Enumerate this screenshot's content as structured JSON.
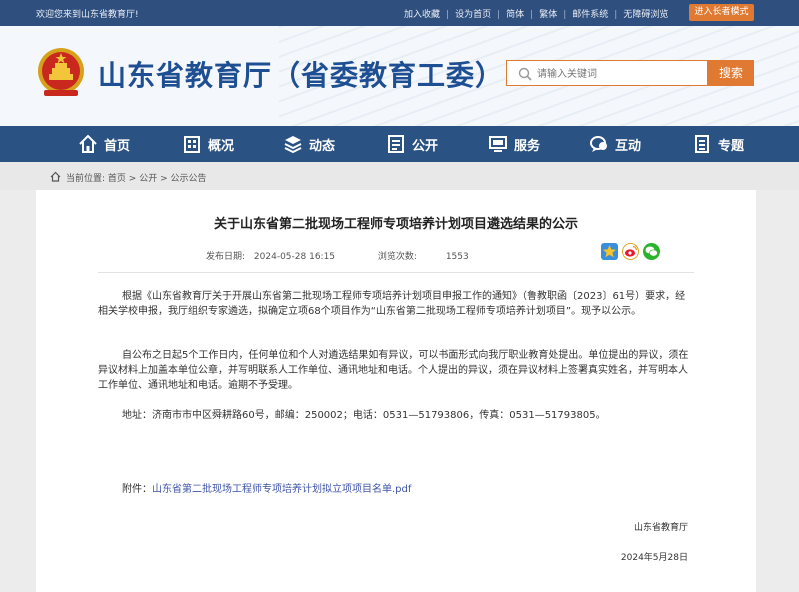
{
  "topbar": {
    "welcome": "欢迎您来到山东省教育厅!",
    "links": [
      "加入收藏",
      "设为首页",
      "简体",
      "繁体",
      "邮件系统",
      "无障碍浏览"
    ],
    "elder_mode": "进入长者模式"
  },
  "header": {
    "site_title": "山东省教育厅（省委教育工委）",
    "search_placeholder": "请输入关键词",
    "search_button": "搜索"
  },
  "nav": {
    "items": [
      {
        "label": "首页",
        "icon": "home-icon"
      },
      {
        "label": "概况",
        "icon": "building-icon"
      },
      {
        "label": "动态",
        "icon": "layers-icon"
      },
      {
        "label": "公开",
        "icon": "document-icon"
      },
      {
        "label": "服务",
        "icon": "monitor-icon"
      },
      {
        "label": "互动",
        "icon": "chat-icon"
      },
      {
        "label": "专题",
        "icon": "list-icon"
      }
    ]
  },
  "breadcrumb": {
    "prefix": "当前位置:",
    "items": [
      "首页",
      "公开",
      "公示公告"
    ]
  },
  "article": {
    "title": "关于山东省第二批现场工程师专项培养计划项目遴选结果的公示",
    "publish_label": "发布日期:",
    "publish_date": "2024-05-28 16:15",
    "views_label": "浏览次数:",
    "views": "1553",
    "paragraphs": [
      "根据《山东省教育厅关于开展山东省第二批现场工程师专项培养计划项目申报工作的通知》（鲁教职函〔2023〕61号）要求，经相关学校申报，我厅组织专家遴选，拟确定立项68个项目作为“山东省第二批现场工程师专项培养计划项目”。现予以公示。",
      "自公布之日起5个工作日内，任何单位和个人对遴选结果如有异议，可以书面形式向我厅职业教育处提出。单位提出的异议，须在异议材料上加盖本单位公章，并写明联系人工作单位、通讯地址和电话。个人提出的异议，须在异议材料上签署真实姓名，并写明本人工作单位、通讯地址和电话。逾期不予受理。",
      "地址：济南市市中区舜耕路60号，邮编：250002；电话：0531—51793806，传真：0531—51793805。"
    ],
    "attachment_label": "附件：",
    "attachment_file": "山东省第二批现场工程师专项培养计划拟立项项目名单.pdf",
    "signature": "山东省教育厅",
    "sign_date": "2024年5月28日"
  },
  "colors": {
    "topbar": "#2f4f7e",
    "nav": "#2a5283",
    "accent": "#e07a32",
    "title": "#1f4f93",
    "link": "#4055a8"
  }
}
